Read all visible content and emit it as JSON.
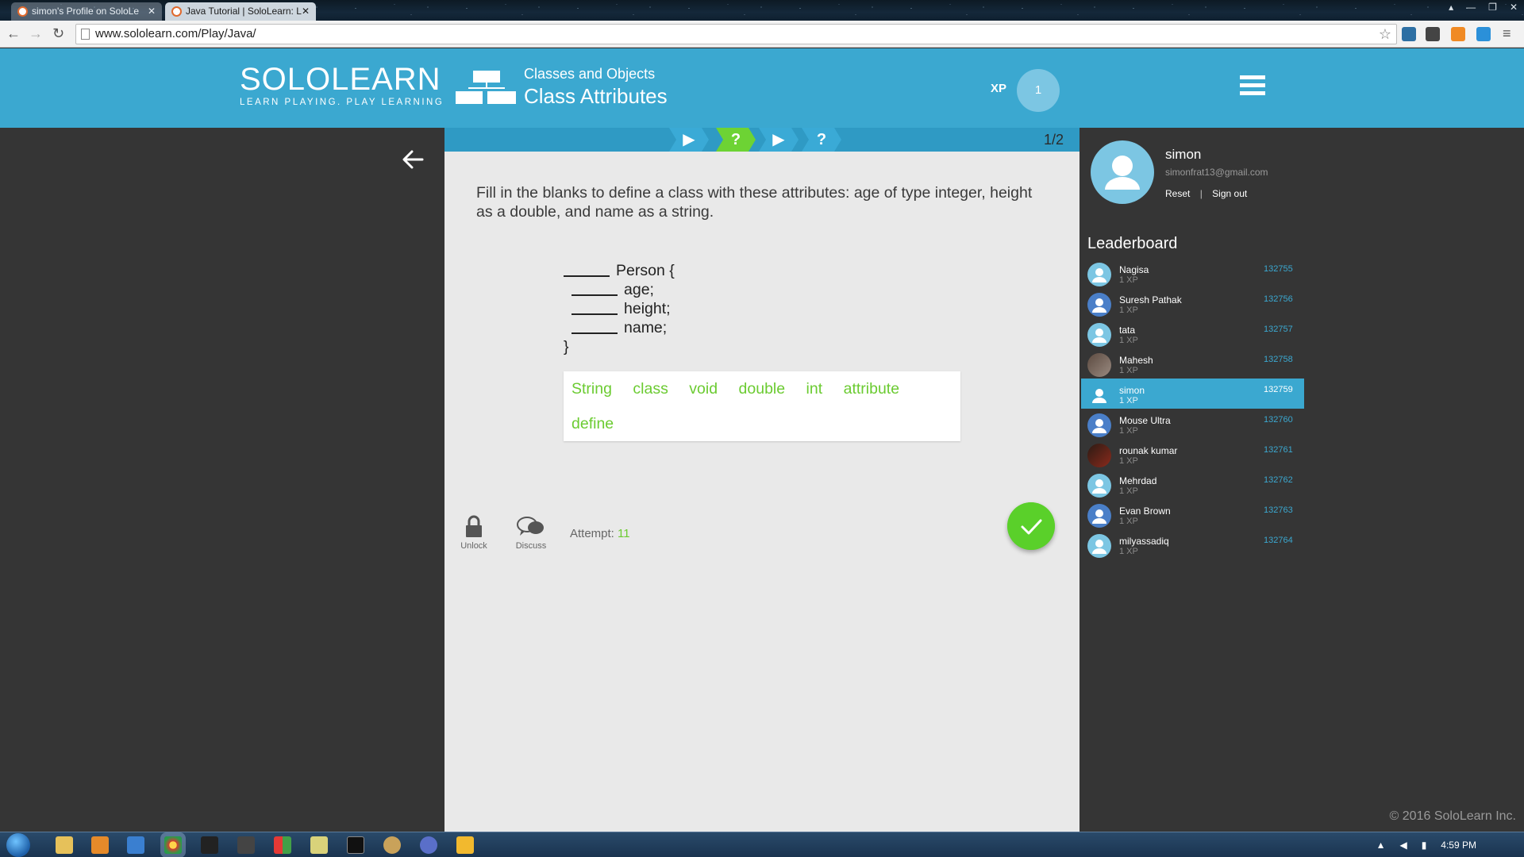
{
  "browser": {
    "tabs": [
      {
        "title": "simon's Profile on SoloLe",
        "active": false
      },
      {
        "title": "Java Tutorial | SoloLearn: L",
        "active": true
      }
    ],
    "url": "www.sololearn.com/Play/Java/",
    "window_controls": [
      "▴",
      "—",
      "❐",
      "✕"
    ]
  },
  "header": {
    "logo": "SOLOLEARN",
    "tagline": "LEARN PLAYING. PLAY LEARNING",
    "lesson_path": "Classes and Objects",
    "lesson_title": "Class Attributes",
    "xp_label": "XP",
    "xp_value": "1"
  },
  "progress": {
    "steps": [
      "▶",
      "?",
      "▶",
      "?"
    ],
    "active_step": 1,
    "count": "1/2"
  },
  "quiz": {
    "question": "Fill in the blanks to define a class with these attributes: age of type integer, height as a double, and name as a string.",
    "code": {
      "line1": "Person {",
      "line2": "age;",
      "line3": "height;",
      "line4": "name;",
      "line5": "}"
    },
    "choices": [
      "String",
      "class",
      "void",
      "double",
      "int",
      "attribute",
      "define"
    ],
    "unlock_label": "Unlock",
    "discuss_label": "Discuss",
    "attempt_label": "Attempt:",
    "attempt_value": "11"
  },
  "profile": {
    "name": "simon",
    "email": "simonfrat13@gmail.com",
    "reset_label": "Reset",
    "signout_label": "Sign out"
  },
  "leaderboard": {
    "title": "Leaderboard",
    "entries": [
      {
        "name": "Nagisa",
        "xp": "1 XP",
        "rank": "132755",
        "avatar": "default"
      },
      {
        "name": "Suresh Pathak",
        "xp": "1 XP",
        "rank": "132756",
        "avatar": "blue"
      },
      {
        "name": "tata",
        "xp": "1 XP",
        "rank": "132757",
        "avatar": "default"
      },
      {
        "name": "Mahesh",
        "xp": "1 XP",
        "rank": "132758",
        "avatar": "photo"
      },
      {
        "name": "simon",
        "xp": "1 XP",
        "rank": "132759",
        "avatar": "default",
        "current": true
      },
      {
        "name": "Mouse Ultra",
        "xp": "1 XP",
        "rank": "132760",
        "avatar": "blue"
      },
      {
        "name": "rounak kumar",
        "xp": "1 XP",
        "rank": "132761",
        "avatar": "photo2"
      },
      {
        "name": "Mehrdad",
        "xp": "1 XP",
        "rank": "132762",
        "avatar": "default"
      },
      {
        "name": "Evan Brown",
        "xp": "1 XP",
        "rank": "132763",
        "avatar": "blue"
      },
      {
        "name": "milyassadiq",
        "xp": "1 XP",
        "rank": "132764",
        "avatar": "default"
      }
    ]
  },
  "footer": {
    "copyright": "© 2016 SoloLearn Inc."
  },
  "taskbar": {
    "clock": "4:59 PM"
  },
  "colors": {
    "brand_blue": "#3ba8d0",
    "accent_green": "#6bcb31",
    "check_green": "#5ad02a",
    "sidebar_bg": "#353535"
  }
}
